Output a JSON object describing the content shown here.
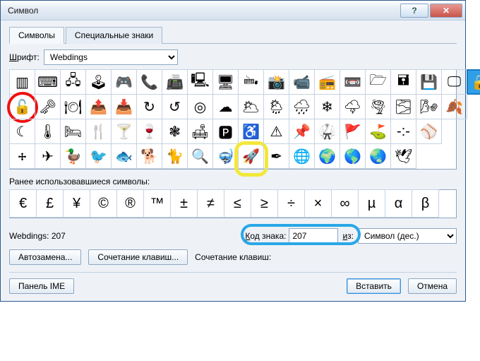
{
  "window": {
    "title": "Символ"
  },
  "tabs": {
    "symbols": "Символы",
    "special": "Специальные знаки"
  },
  "font": {
    "label_html": "Шрифт:",
    "value": "Webdings"
  },
  "grid": {
    "rows": [
      [
        "▥",
        "⌨",
        "🖧",
        "🕹",
        "🎮",
        "📞",
        "📠",
        "🖳",
        "🖥",
        "🖦",
        "📸",
        "📹",
        "📻",
        "📼",
        "🗁",
        "🖬",
        "💾",
        "🖵",
        "🔒"
      ],
      [
        "🔓",
        "🗝",
        "🍽",
        "📤",
        "📥",
        "↻",
        "↺",
        "◎",
        "☁",
        "🌥",
        "🌦",
        "🌧",
        "❄",
        "🌩",
        "🌪",
        "🌫",
        "🌬",
        "🍂"
      ],
      [
        "☾",
        "🌡",
        "🛏",
        "🍴",
        "🍸",
        "🍷",
        "❃",
        "🛋",
        "🅿",
        "♿",
        "⚠",
        "📌",
        "🥋",
        "🚩",
        "⛳",
        "-:-",
        "⚾"
      ],
      [
        "🕂",
        "✈",
        "🦆",
        "🐦",
        "🐟",
        "🐕",
        "🐈",
        "🔍",
        "🤿",
        "🚀",
        "✒",
        "🌐",
        "🌍",
        "🌎",
        "🌏",
        "🕊"
      ]
    ],
    "selected": {
      "row": 0,
      "col": 18
    },
    "red_mark": {
      "row": 1,
      "col": 0
    },
    "yellow_mark": {
      "row": 3,
      "col": 9
    }
  },
  "recent": {
    "label": "Ранее использовавшиеся символы:",
    "items": [
      "€",
      "£",
      "¥",
      "©",
      "®",
      "™",
      "±",
      "≠",
      "≤",
      "≥",
      "÷",
      "×",
      "∞",
      "µ",
      "α",
      "β"
    ]
  },
  "info": {
    "font_code": "Webdings: 207"
  },
  "code": {
    "label": "Код знака:",
    "value": "207"
  },
  "from": {
    "label": "из:",
    "value": "Символ (дес.)"
  },
  "buttons": {
    "autocorrect": "Автозамена...",
    "shortcut": "Сочетание клавиш...",
    "shortcut_label": "Сочетание клавиш:",
    "ime": "Панель IME",
    "insert": "Вставить",
    "cancel": "Отмена"
  }
}
